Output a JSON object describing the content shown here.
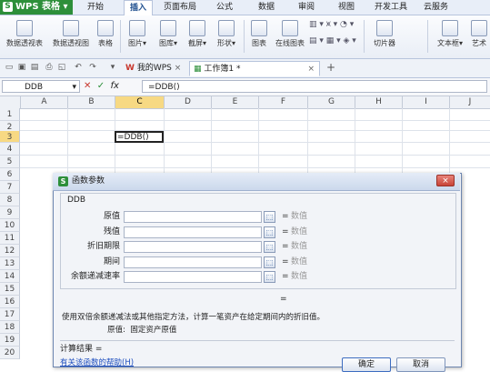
{
  "app": {
    "name": "WPS 表格",
    "logo_letter": "S"
  },
  "menu": [
    "开始",
    "插入",
    "页面布局",
    "公式",
    "数据",
    "审阅",
    "视图",
    "开发工具",
    "云服务"
  ],
  "menu_active": "插入",
  "ribbon": {
    "groups": [
      {
        "label": "数据透视表"
      },
      {
        "label": "数据透视图"
      },
      {
        "label": "表格"
      },
      {
        "label": "图片",
        "dropdown": "▾"
      },
      {
        "label": "图库",
        "dropdown": "▾"
      },
      {
        "label": "截屏",
        "dropdown": "▾"
      },
      {
        "label": "形状",
        "dropdown": "▾"
      },
      {
        "label": "图表"
      },
      {
        "label": "在线图表"
      },
      {
        "label": "切片器"
      },
      {
        "label": "文本框",
        "dropdown": "▾"
      },
      {
        "label": "艺术"
      }
    ]
  },
  "doc_tabs": [
    {
      "label": "我的WPS",
      "close": "×"
    },
    {
      "label": "工作簿1 *",
      "close": "×"
    }
  ],
  "new_tab": "+",
  "formula_bar": {
    "name_box": "DDB",
    "cancel": "✕",
    "confirm": "✓",
    "fx": "fx",
    "formula": "=DDB()"
  },
  "columns": [
    "A",
    "B",
    "C",
    "D",
    "E",
    "F",
    "G",
    "H",
    "I",
    "J"
  ],
  "selected_column": "C",
  "rows": [
    "1",
    "2",
    "3",
    "4",
    "5",
    "6",
    "7",
    "8",
    "9",
    "10",
    "11",
    "12",
    "13",
    "14",
    "15",
    "16",
    "17",
    "18",
    "19",
    "20"
  ],
  "selected_row": "3",
  "active_cell": {
    "ref": "C3",
    "value": "=DDB()"
  },
  "dialog": {
    "title": "函数参数",
    "function_name": "DDB",
    "params": [
      {
        "label": "原值",
        "value": "",
        "eq": "=",
        "result": "数值"
      },
      {
        "label": "残值",
        "value": "",
        "eq": "=",
        "result": "数值"
      },
      {
        "label": "折旧期限",
        "value": "",
        "eq": "=",
        "result": "数值"
      },
      {
        "label": "期间",
        "value": "",
        "eq": "=",
        "result": "数值"
      },
      {
        "label": "余额递减速率",
        "value": "",
        "eq": "=",
        "result": "数值"
      }
    ],
    "eq_mid": "=",
    "description": "使用双倍余额递减法或其他指定方法，计算一笔资产在给定期间内的折旧值。",
    "param_desc_label": "原值:",
    "param_desc_text": "固定资产原值",
    "calc_label": "计算结果 =",
    "help_link": "有关该函数的帮助(H)",
    "ok": "确定",
    "cancel": "取消",
    "close_icon": "×"
  }
}
